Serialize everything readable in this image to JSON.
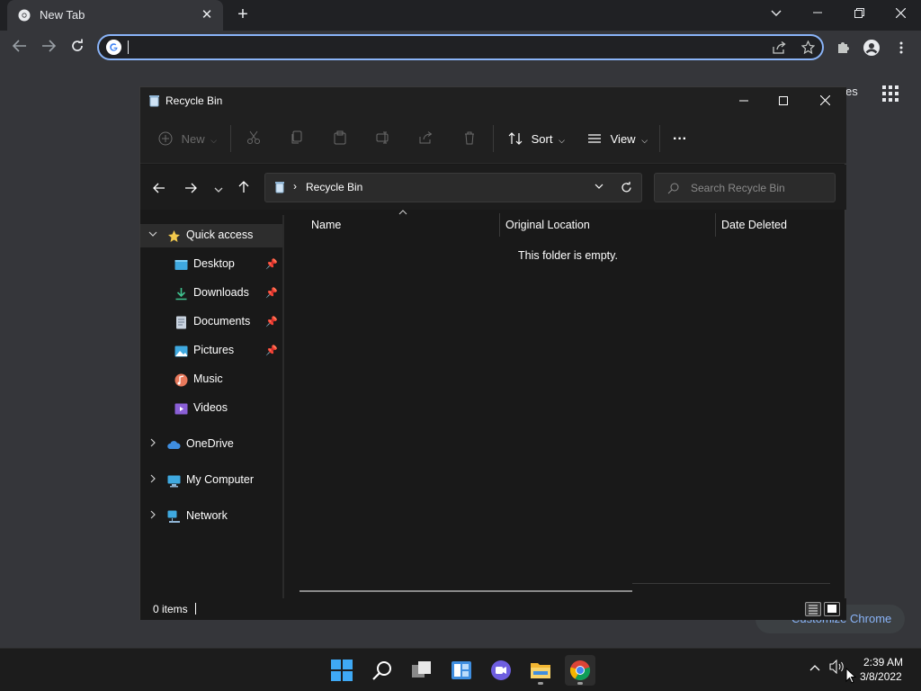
{
  "chrome": {
    "tab_title": "New Tab",
    "tab_close": "✕",
    "new_tab": "+",
    "omnibox_value": "",
    "partial_text": "es",
    "customize_label": "Customize Chrome"
  },
  "explorer": {
    "title": "Recycle Bin",
    "commands": {
      "new_label": "New",
      "sort_label": "Sort",
      "view_label": "View",
      "more_label": "···"
    },
    "address": {
      "breadcrumb": "Recycle Bin",
      "separator": "›"
    },
    "search_placeholder": "Search Recycle Bin",
    "nav": {
      "quick_access": "Quick access",
      "desktop": "Desktop",
      "downloads": "Downloads",
      "documents": "Documents",
      "pictures": "Pictures",
      "music": "Music",
      "videos": "Videos",
      "onedrive": "OneDrive",
      "my_computer": "My Computer",
      "network": "Network"
    },
    "columns": {
      "name": "Name",
      "original_location": "Original Location",
      "date_deleted": "Date Deleted"
    },
    "empty_message": "This folder is empty.",
    "status_count": "0 items"
  },
  "taskbar": {
    "time": "2:39 AM",
    "date": "3/8/2022"
  },
  "colors": {
    "accent": "#8ab4f8",
    "explorer_bg": "#191919",
    "taskbar_bg": "#1c1c1c",
    "chrome_bg": "#35363a"
  }
}
